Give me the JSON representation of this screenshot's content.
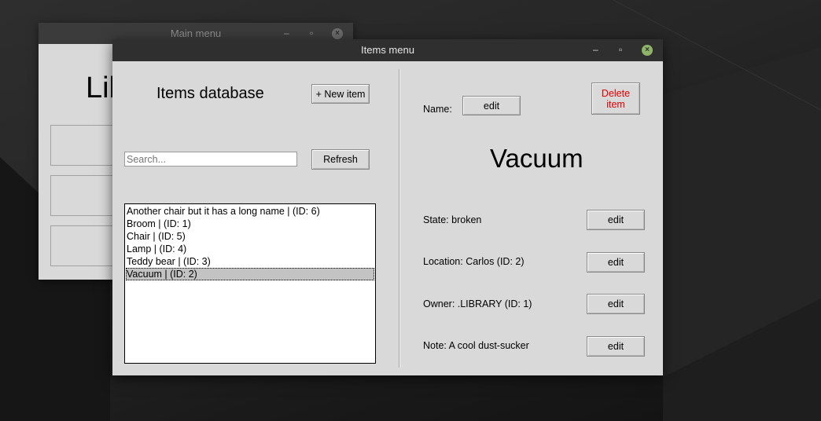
{
  "main_window": {
    "title": "Main menu",
    "heading_partial": "Lib"
  },
  "items_window": {
    "title": "Items menu",
    "window_controls": {
      "minimize": "–",
      "maximize": "▫",
      "close": "×"
    },
    "left": {
      "heading": "Items database",
      "new_item_label": "+ New item",
      "search_placeholder": "Search...",
      "search_value": "",
      "refresh_label": "Refresh",
      "items": [
        "Another chair but it has a long name | (ID: 6)",
        "Broom | (ID: 1)",
        "Chair | (ID: 5)",
        "Lamp | (ID: 4)",
        "Teddy bear | (ID: 3)",
        "Vacuum | (ID: 2)"
      ],
      "selected_index": 5
    },
    "right": {
      "name_label": "Name:",
      "name_edit_label": "edit",
      "delete_label": "Delete item",
      "item_name": "Vacuum",
      "state_text": "State: broken",
      "location_text": "Location: Carlos (ID: 2)",
      "owner_text": "Owner: .LIBRARY (ID: 1)",
      "note_text": "Note: A cool dust-sucker",
      "edit_label": "edit"
    }
  },
  "colors": {
    "delete_text": "#e00000",
    "close_button": "#8fb36a",
    "window_bg": "#d9d9d9",
    "titlebar": "#2f2f2f"
  }
}
